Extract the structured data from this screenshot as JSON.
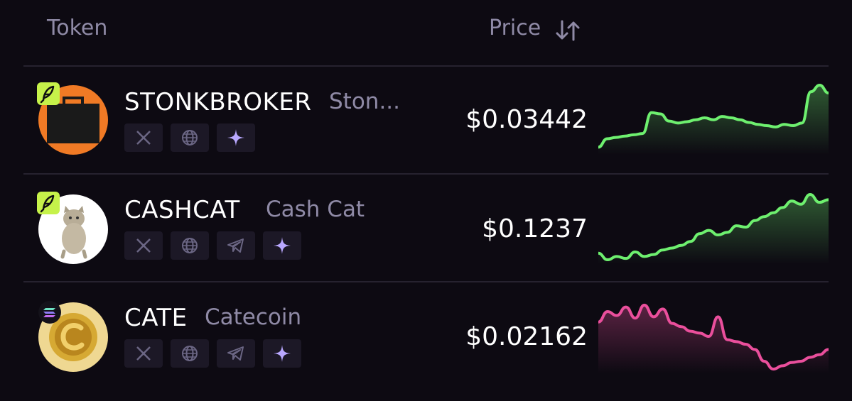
{
  "header": {
    "token_label": "Token",
    "price_label": "Price",
    "sort_icon": "sort-arrows-icon"
  },
  "colors": {
    "background": "#0d0a12",
    "muted_text": "#8f8aa6",
    "up": "#6ef06f",
    "down": "#ea4f9c",
    "accent": "#b9a8ff"
  },
  "tokens": [
    {
      "symbol": "STONKBROKER",
      "name": "Ston...",
      "price": "$0.03442",
      "trend": "up",
      "badge_icon": "feather-icon",
      "links": [
        "x-icon",
        "globe-icon",
        "sparkle-icon"
      ],
      "sparkline": [
        0.05,
        0.18,
        0.2,
        0.22,
        0.24,
        0.26,
        0.58,
        0.56,
        0.45,
        0.42,
        0.44,
        0.47,
        0.5,
        0.47,
        0.52,
        0.5,
        0.47,
        0.43,
        0.4,
        0.38,
        0.36,
        0.4,
        0.38,
        0.42,
        0.9,
        1.0,
        0.88
      ]
    },
    {
      "symbol": "CASHCAT",
      "name": "Cash Cat",
      "price": "$0.1237",
      "trend": "up",
      "badge_icon": "feather-icon",
      "links": [
        "x-icon",
        "globe-icon",
        "telegram-icon",
        "sparkle-icon"
      ],
      "sparkline": [
        0.1,
        0.0,
        0.05,
        0.02,
        0.12,
        0.05,
        0.08,
        0.15,
        0.18,
        0.22,
        0.28,
        0.4,
        0.45,
        0.38,
        0.42,
        0.52,
        0.5,
        0.6,
        0.66,
        0.72,
        0.8,
        0.9,
        0.85,
        1.0,
        0.88,
        0.92
      ]
    },
    {
      "symbol": "CATE",
      "name": "Catecoin",
      "price": "$0.02162",
      "trend": "down",
      "badge_icon": "solana-icon",
      "links": [
        "x-icon",
        "globe-icon",
        "telegram-icon",
        "sparkle-icon"
      ],
      "sparkline": [
        0.72,
        0.88,
        0.82,
        0.95,
        0.78,
        0.98,
        0.8,
        0.92,
        0.7,
        0.65,
        0.58,
        0.55,
        0.5,
        0.8,
        0.45,
        0.42,
        0.38,
        0.3,
        0.12,
        0.0,
        0.05,
        0.1,
        0.12,
        0.18,
        0.22,
        0.3
      ]
    }
  ]
}
